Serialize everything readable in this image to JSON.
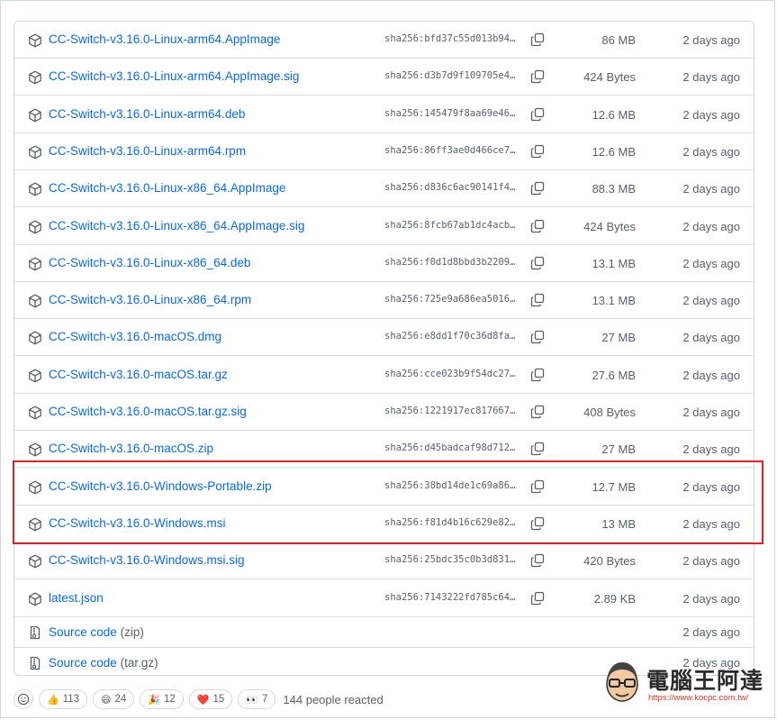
{
  "assets": [
    {
      "name": "CC-Switch-v3.16.0-Linux-arm64.AppImage",
      "sha": "sha256:bfd37c55d013b948...",
      "size": "86 MB",
      "date": "2 days ago"
    },
    {
      "name": "CC-Switch-v3.16.0-Linux-arm64.AppImage.sig",
      "sha": "sha256:d3b7d9f109705e45...",
      "size": "424 Bytes",
      "date": "2 days ago"
    },
    {
      "name": "CC-Switch-v3.16.0-Linux-arm64.deb",
      "sha": "sha256:145479f8aa69e462...",
      "size": "12.6 MB",
      "date": "2 days ago"
    },
    {
      "name": "CC-Switch-v3.16.0-Linux-arm64.rpm",
      "sha": "sha256:86ff3ae0d466ce76...",
      "size": "12.6 MB",
      "date": "2 days ago"
    },
    {
      "name": "CC-Switch-v3.16.0-Linux-x86_64.AppImage",
      "sha": "sha256:d836c6ac90141f4d...",
      "size": "88.3 MB",
      "date": "2 days ago"
    },
    {
      "name": "CC-Switch-v3.16.0-Linux-x86_64.AppImage.sig",
      "sha": "sha256:8fcb67ab1dc4acb3...",
      "size": "424 Bytes",
      "date": "2 days ago"
    },
    {
      "name": "CC-Switch-v3.16.0-Linux-x86_64.deb",
      "sha": "sha256:f0d1d8bbd3b22099...",
      "size": "13.1 MB",
      "date": "2 days ago"
    },
    {
      "name": "CC-Switch-v3.16.0-Linux-x86_64.rpm",
      "sha": "sha256:725e9a686ea50160...",
      "size": "13.1 MB",
      "date": "2 days ago"
    },
    {
      "name": "CC-Switch-v3.16.0-macOS.dmg",
      "sha": "sha256:e8dd1f70c36d8fa4...",
      "size": "27 MB",
      "date": "2 days ago"
    },
    {
      "name": "CC-Switch-v3.16.0-macOS.tar.gz",
      "sha": "sha256:cce023b9f54dc276...",
      "size": "27.6 MB",
      "date": "2 days ago"
    },
    {
      "name": "CC-Switch-v3.16.0-macOS.tar.gz.sig",
      "sha": "sha256:1221917ec817667e...",
      "size": "408 Bytes",
      "date": "2 days ago"
    },
    {
      "name": "CC-Switch-v3.16.0-macOS.zip",
      "sha": "sha256:d45badcaf98d712c...",
      "size": "27 MB",
      "date": "2 days ago"
    },
    {
      "name": "CC-Switch-v3.16.0-Windows-Portable.zip",
      "sha": "sha256:38bd14de1c69a865...",
      "size": "12.7 MB",
      "date": "2 days ago"
    },
    {
      "name": "CC-Switch-v3.16.0-Windows.msi",
      "sha": "sha256:f81d4b16c629e824...",
      "size": "13 MB",
      "date": "2 days ago"
    },
    {
      "name": "CC-Switch-v3.16.0-Windows.msi.sig",
      "sha": "sha256:25bdc35c0b3d831c...",
      "size": "420 Bytes",
      "date": "2 days ago"
    },
    {
      "name": "latest.json",
      "sha": "sha256:7143222fd785c64d...",
      "size": "2.89 KB",
      "date": "2 days ago"
    }
  ],
  "source_code": [
    {
      "label": "Source code",
      "suffix": "(zip)",
      "date": "2 days ago"
    },
    {
      "label": "Source code",
      "suffix": "(tar.gz)",
      "date": "2 days ago"
    }
  ],
  "reactions": {
    "items": [
      {
        "emoji": "👍",
        "icon": "thumbs-up",
        "count": "113"
      },
      {
        "emoji": "😄",
        "icon": "laugh",
        "count": "24"
      },
      {
        "emoji": "🎉",
        "icon": "hooray",
        "count": "12"
      },
      {
        "emoji": "❤️",
        "icon": "heart",
        "count": "15"
      },
      {
        "emoji": "👀",
        "icon": "eyes",
        "count": "7"
      }
    ],
    "summary": "144 people reacted"
  },
  "watermark": {
    "title": "電腦王阿達",
    "url": "https://www.kocpc.com.tw/"
  },
  "colors": {
    "link": "#0969da",
    "muted": "#57606a",
    "border": "#d0d7de",
    "highlight": "#d6242b"
  }
}
